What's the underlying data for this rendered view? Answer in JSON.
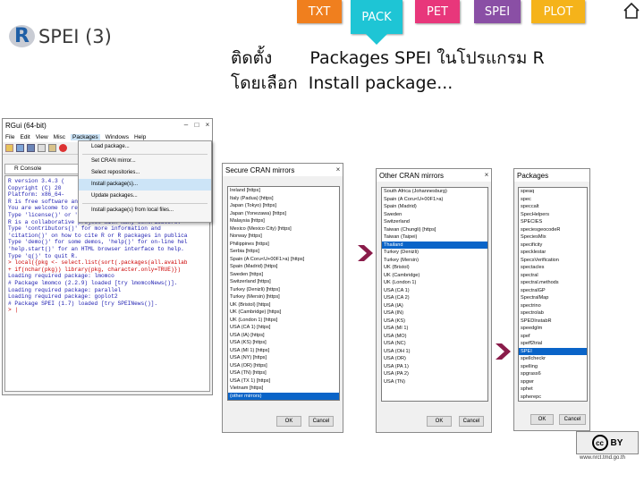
{
  "nav": {
    "tabs": [
      {
        "label": "TXT",
        "color": "#f07f1e"
      },
      {
        "label": "PACK",
        "color": "#1ec5d5"
      },
      {
        "label": "PET",
        "color": "#e8377b"
      },
      {
        "label": "SPEI",
        "color": "#8a4fa5"
      },
      {
        "label": "PLOT",
        "color": "#f5b31a"
      }
    ]
  },
  "logo": {
    "r": "R",
    "text": "SPEI (3)"
  },
  "header": {
    "line1_thai": "ติดตั้ง",
    "line1": "Packages SPEI ในโปรแกรม R",
    "line2_thai": "โดยเลือก",
    "line2": "Install package..."
  },
  "rgui": {
    "title": "RGui (64-bit)",
    "menus": [
      "File",
      "Edit",
      "View",
      "Misc",
      "Packages",
      "Windows",
      "Help"
    ],
    "console_title": "R Console",
    "packages_menu": [
      "Load package...",
      "Set CRAN mirror...",
      "Select repositories...",
      "Install package(s)...",
      "Update packages...",
      "Install package(s) from local files..."
    ],
    "console_lines": [
      "R version 3.4.3 (",
      "Copyright (C) 20",
      "Platform: x86_64-",
      "",
      "R is free software and comes with ABSOLUTELY NO WARRAN",
      "You are welcome to redistribute it under certain condi",
      "Type 'license()' or 'licence()' for distribution detai",
      "",
      "R is a collaborative project with many contributors.",
      "Type 'contributors()' for more information and",
      "'citation()' on how to cite R or R packages in publica",
      "",
      "Type 'demo()' for some demos, 'help()' for on-line hel",
      "'help.start()' for an HTML browser interface to help.",
      "Type 'q()' to quit R.",
      "",
      "> local({pkg <- select.list(sort(.packages(all.availab",
      "+ if(nchar(pkg)) library(pkg, character.only=TRUE)})",
      "Loading required package: lmomco",
      "# Package lmomco (2.2.9) loaded [try lmomcoNews()].",
      "Loading required package: parallel",
      "Loading required package: goplot2",
      "# Package SPEI (1.7) loaded [try SPEINews()].",
      "> |"
    ]
  },
  "secure": {
    "title": "Secure CRAN mirrors",
    "items": [
      "Ireland [https]",
      "Italy (Padua) [https]",
      "Japan (Tokyo) [https]",
      "Japan (Yonezawa) [https]",
      "Malaysia [https]",
      "Mexico (Mexico City) [https]",
      "Norway [https]",
      "Philippines [https]",
      "Serbia [https]",
      "Spain (A Coru<U+00F1>a) [https]",
      "Spain (Madrid) [https]",
      "Sweden [https]",
      "Switzerland [https]",
      "Turkey (Denizli) [https]",
      "Turkey (Mersin) [https]",
      "UK (Bristol) [https]",
      "UK (Cambridge) [https]",
      "UK (London 1) [https]",
      "USA (CA 1) [https]",
      "USA (IA) [https]",
      "USA (KS) [https]",
      "USA (MI 1) [https]",
      "USA (NY) [https]",
      "USA (OR) [https]",
      "USA (TN) [https]",
      "USA (TX 1) [https]",
      "Vietnam [https]",
      "(other mirrors)"
    ],
    "selected": 27,
    "ok": "OK",
    "cancel": "Cancel"
  },
  "other": {
    "title": "Other CRAN mirrors",
    "items": [
      "South Africa (Johannesburg)",
      "Spain (A Coru<U+00F1>a)",
      "Spain (Madrid)",
      "Sweden",
      "Switzerland",
      "Taiwan (Chungli) [https]",
      "Taiwan (Taipei)",
      "Thailand",
      "Turkey (Denizli)",
      "Turkey (Mersin)",
      "UK (Bristol)",
      "UK (Cambridge)",
      "UK (London 1)",
      "USA (CA 1)",
      "USA (CA 2)",
      "USA (IA)",
      "USA (IN)",
      "USA (KS)",
      "USA (MI 1)",
      "USA (MO)",
      "USA (NC)",
      "USA (OH 1)",
      "USA (OR)",
      "USA (PA 1)",
      "USA (PA 2)",
      "USA (TN)"
    ],
    "selected": 7,
    "ok": "OK",
    "cancel": "Cancel"
  },
  "packages": {
    "title": "Packages",
    "items": [
      "speaq",
      "spec",
      "speccalt",
      "SpecHelpers",
      "SPECIES",
      "speciesgeocodeR",
      "SpeciesMix",
      "specificity",
      "specklestar",
      "SpecsVerification",
      "spectacles",
      "spectral",
      "spectral.methods",
      "spectralGP",
      "SpectralMap",
      "spectrino",
      "spectrolab",
      "SPEDInstabR",
      "speedglm",
      "spef",
      "speff2trial",
      "SPEI",
      "spellcheckr",
      "spelling",
      "spgrass6",
      "spgwr",
      "sphet",
      "spherepc",
      "spew",
      "spikes"
    ],
    "selected": 21,
    "ok": "OK",
    "cancel": "Cancel"
  },
  "footer": {
    "cc": "cc",
    "by": "BY",
    "url": "www.nrct.tmd.go.th"
  }
}
